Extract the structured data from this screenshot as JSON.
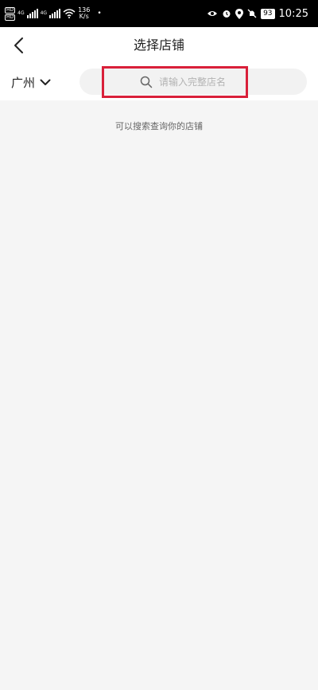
{
  "status_bar": {
    "hd_label": "HD",
    "network_1": "4G",
    "network_2": "4G",
    "speed_value": "136",
    "speed_unit": "K/s",
    "battery": "93",
    "time": "10:25"
  },
  "header": {
    "title": "选择店铺"
  },
  "search_row": {
    "city": "广州",
    "placeholder": "请输入完整店名",
    "value": ""
  },
  "content": {
    "hint": "可以搜索查询你的店铺"
  },
  "colors": {
    "highlight": "#d9203a",
    "background": "#f5f5f5"
  }
}
